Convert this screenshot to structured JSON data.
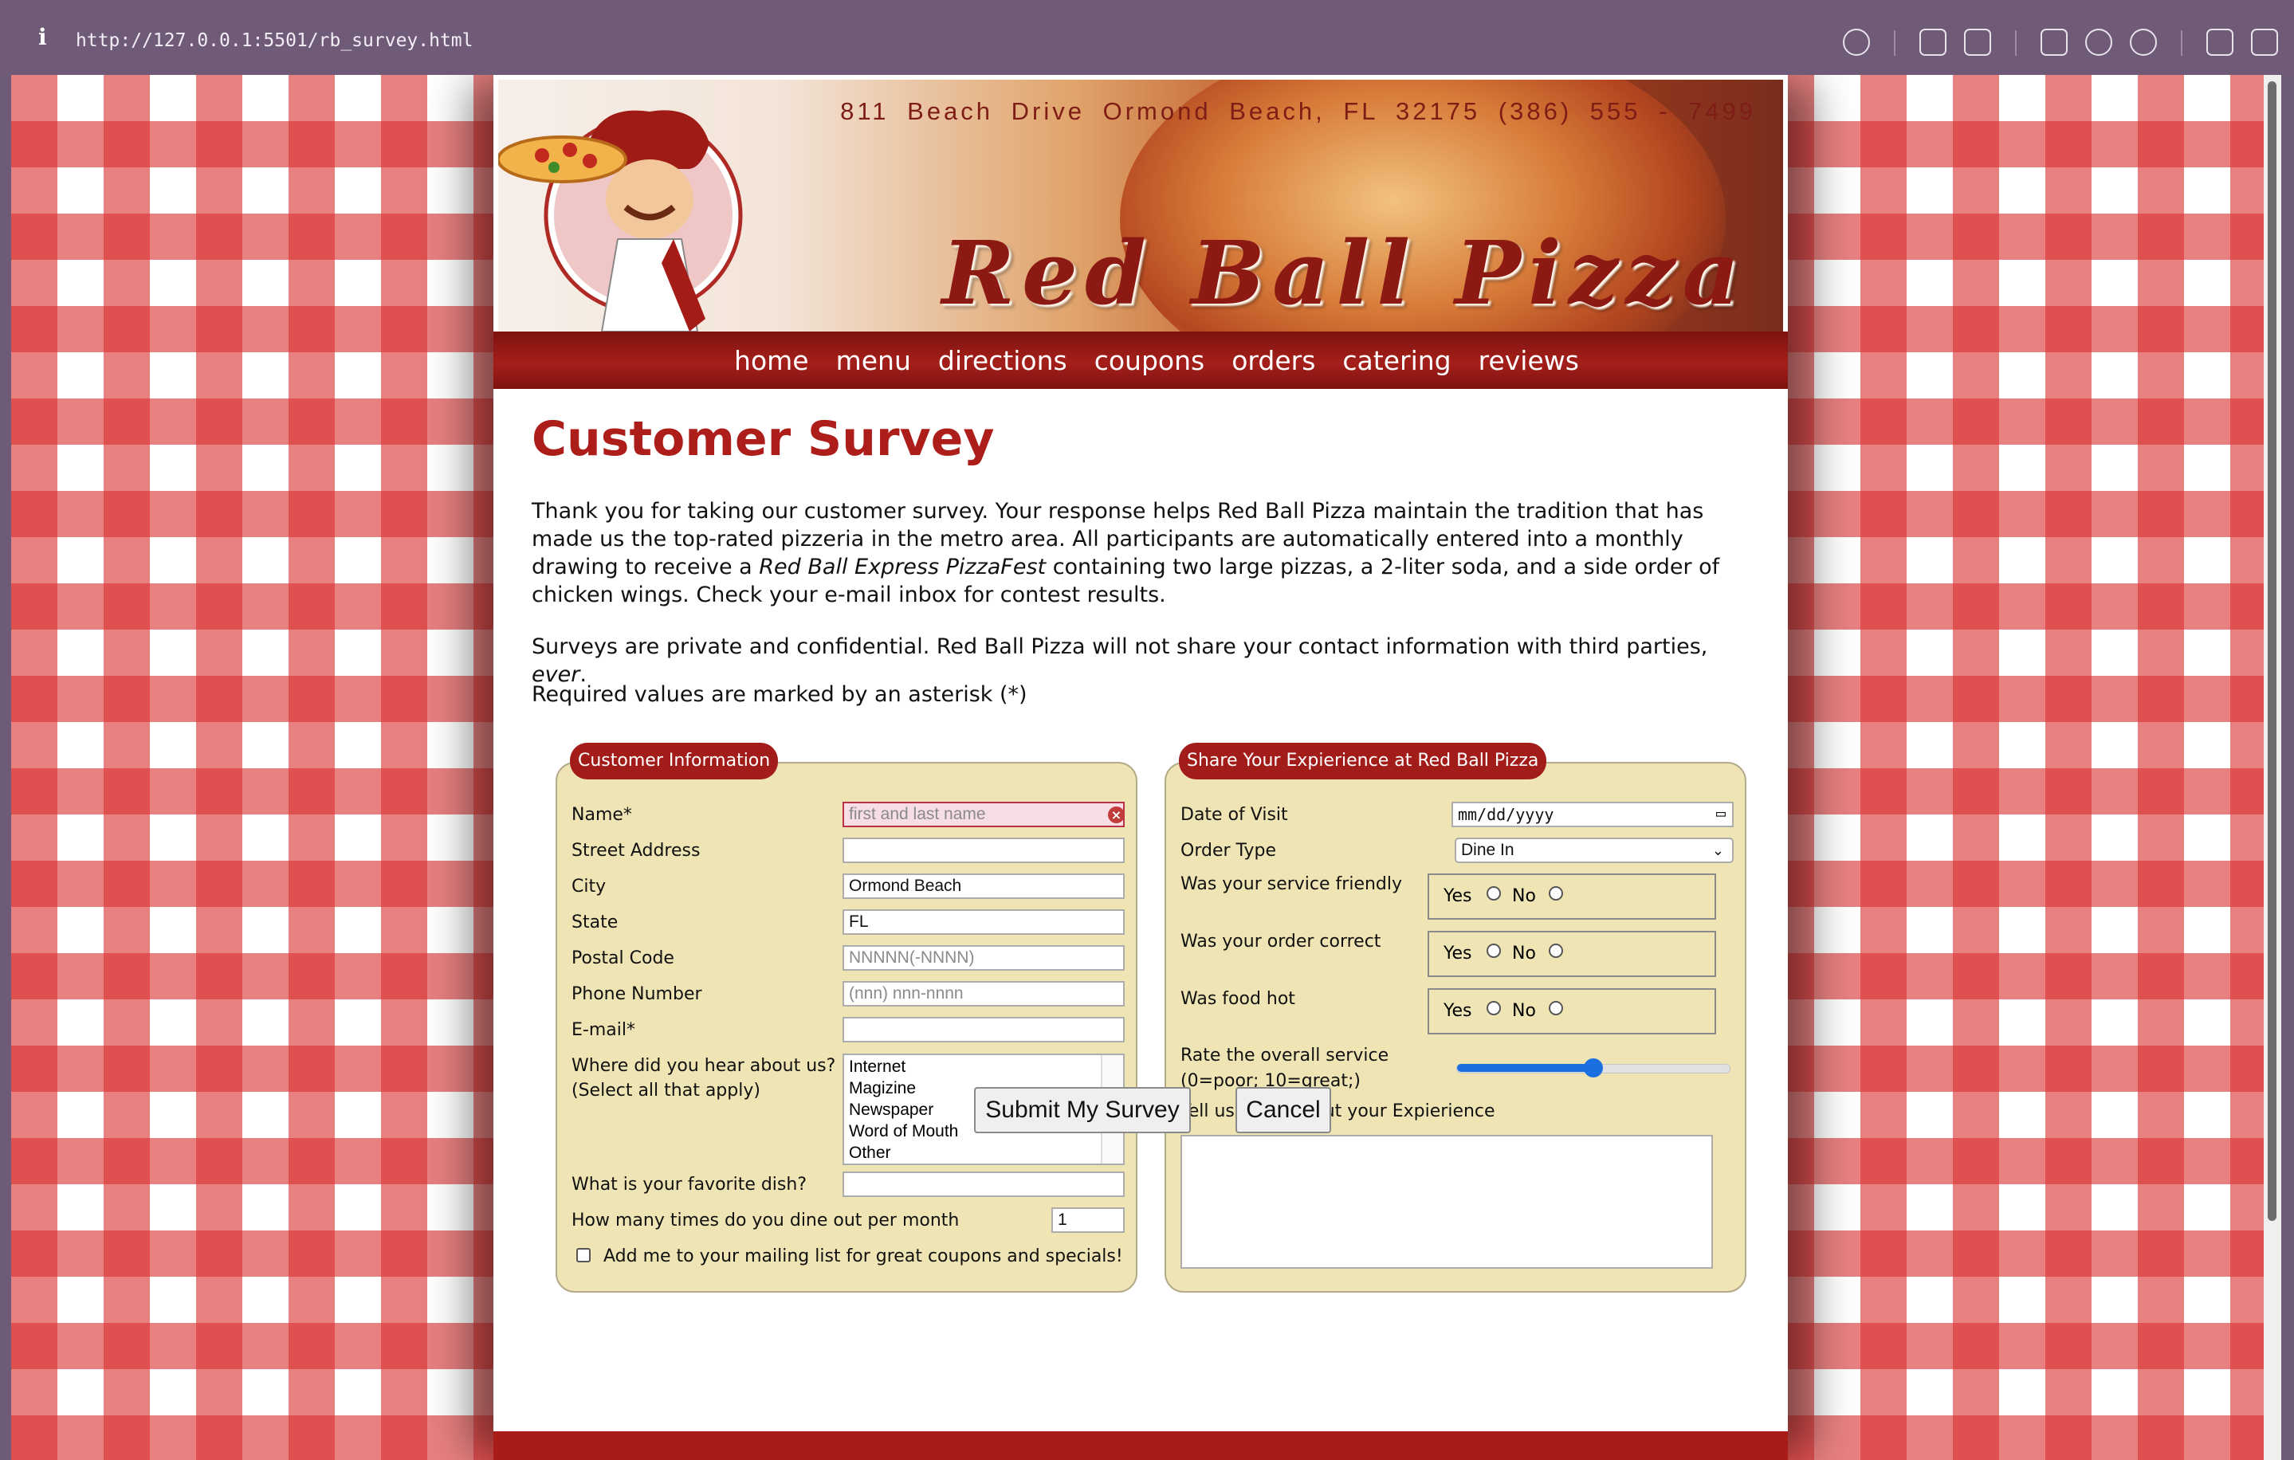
{
  "browser": {
    "info_icon": "i",
    "url": "http://127.0.0.1:5501/rb_survey.html",
    "toolbar_icons": [
      "link-icon",
      "screenshot-area-icon",
      "camera-icon",
      "terminal-icon",
      "globe-icon",
      "crosshair-icon",
      "extension-icon",
      "sidebar-icon"
    ]
  },
  "header": {
    "address": "811 Beach Drive  Ormond Beach, FL  32175   (386) 555 - 7499",
    "title": "Red Ball Pizza"
  },
  "nav": [
    "home",
    "menu",
    "directions",
    "coupons",
    "orders",
    "catering",
    "reviews"
  ],
  "page": {
    "heading": "Customer Survey",
    "intro_1": "Thank you for taking our customer survey. Your response helps Red Ball Pizza maintain the tradition that has made us the top-rated pizzeria in the metro area. All participants are automatically entered into a monthly drawing to receive a ",
    "intro_italic": "Red Ball Express PizzaFest",
    "intro_2": " containing two large pizzas, a 2-liter soda, and a side order of chicken wings. Check your e-mail inbox for contest results.",
    "privacy_1": "Surveys are private and confidential. Red Ball Pizza will not share your contact information with third parties, ",
    "privacy_italic": "ever",
    "privacy_2": ".",
    "required_note": "Required values are marked by an asterisk (*)"
  },
  "customer": {
    "legend": "Customer Information",
    "name_label": "Name*",
    "name_placeholder": "first and last name",
    "street_label": "Street Address",
    "street_value": "",
    "city_label": "City",
    "city_value": "Ormond Beach",
    "state_label": "State",
    "state_value": "FL",
    "postal_label": "Postal Code",
    "postal_placeholder": "NNNNN(-NNNN)",
    "phone_label": "Phone Number",
    "phone_placeholder": "(nnn) nnn-nnnn",
    "email_label": "E-mail*",
    "email_value": "",
    "hear_label_1": "Where did you hear about us?",
    "hear_label_2": "(Select all that apply)",
    "hear_options": [
      "Internet",
      "Magizine",
      "Newspaper",
      "Word of Mouth",
      "Other"
    ],
    "dish_label": "What is your favorite dish?",
    "dish_value": "",
    "dine_label": "How many times do you dine out per month",
    "dine_value": "1",
    "mailing_label": "Add me to your mailing list for great coupons and specials!"
  },
  "experience": {
    "legend": "Share Your Expierience at Red Ball Pizza",
    "date_label": "Date of Visit",
    "date_value": "mm/dd/yyyy",
    "order_label": "Order Type",
    "order_value": "Dine In",
    "friendly_label": "Was your service friendly",
    "correct_label": "Was your order correct",
    "hot_label": "Was food hot",
    "yes": "Yes",
    "no": "No",
    "rate_label_1": "Rate the overall service",
    "rate_label_2": "(0=poor; 10=great;)",
    "rate_value": 5,
    "rate_max": 10,
    "more_label": "Tell us more about your Expierience",
    "more_value": ""
  },
  "buttons": {
    "submit": "Submit My Survey",
    "cancel": "Cancel"
  },
  "colors": {
    "brand_red": "#ad1e1b",
    "fieldset_bg": "#eee4b4",
    "slider": "#1c6fe0"
  }
}
